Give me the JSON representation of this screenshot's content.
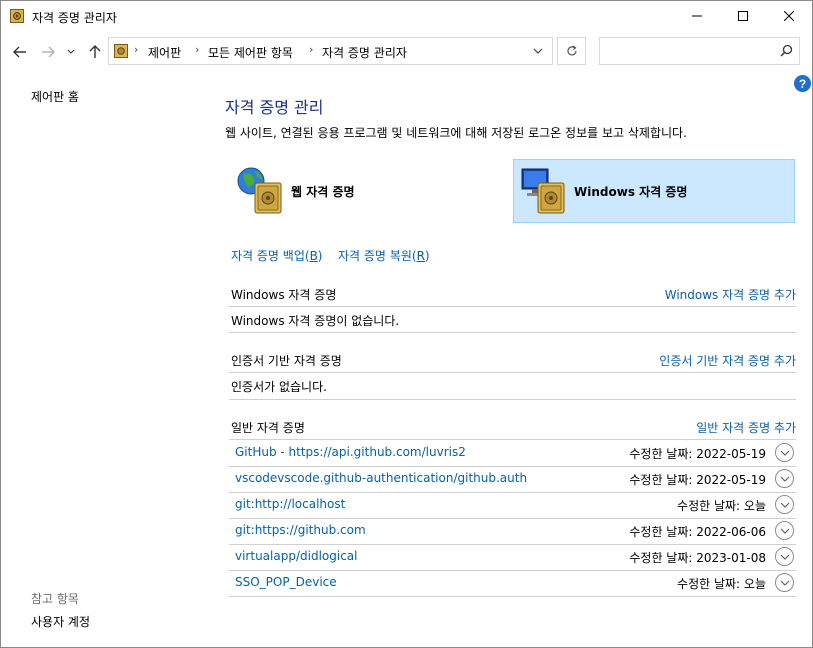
{
  "window": {
    "title": "자격 증명 관리자"
  },
  "address": {
    "crumbs": [
      "제어판",
      "모든 제어판 항목",
      "자격 증명 관리자"
    ],
    "search_placeholder": ""
  },
  "help_label": "?",
  "sidebar": {
    "home": "제어판 홈",
    "see_also": "참고 항목",
    "user_accounts": "사용자 계정"
  },
  "main": {
    "title": "자격 증명 관리",
    "description": "웹 사이트, 연결된 응용 프로그램 및 네트워크에 대해 저장된 로그온 정보를 보고 삭제합니다.",
    "tiles": {
      "web": "웹 자격 증명",
      "windows": "Windows 자격 증명"
    },
    "backup_text": "자격 증명 백업(",
    "backup_key": "B",
    "backup_end": ")",
    "restore_text": "자격 증명 복원(",
    "restore_key": "R",
    "restore_end": ")",
    "sections": {
      "windows": {
        "label": "Windows 자격 증명",
        "add": "Windows 자격 증명 추가",
        "empty": "Windows 자격 증명이 없습니다."
      },
      "certificate": {
        "label": "인증서 기반 자격 증명",
        "add": "인증서 기반 자격 증명 추가",
        "empty": "인증서가 없습니다."
      },
      "generic": {
        "label": "일반 자격 증명",
        "add": "일반 자격 증명 추가",
        "items": [
          {
            "name": "GitHub - https://api.github.com/luvris2",
            "modified": "수정한 날짜:  2022-05-19"
          },
          {
            "name": "vscodevscode.github-authentication/github.auth",
            "modified": "수정한 날짜:  2022-05-19"
          },
          {
            "name": "git:http://localhost",
            "modified": "수정한 날짜:  오늘"
          },
          {
            "name": "git:https://github.com",
            "modified": "수정한 날짜:  2022-06-06"
          },
          {
            "name": "virtualapp/didlogical",
            "modified": "수정한 날짜:  2023-01-08"
          },
          {
            "name": "SSO_POP_Device",
            "modified": "수정한 날짜:  오늘"
          }
        ]
      }
    }
  }
}
